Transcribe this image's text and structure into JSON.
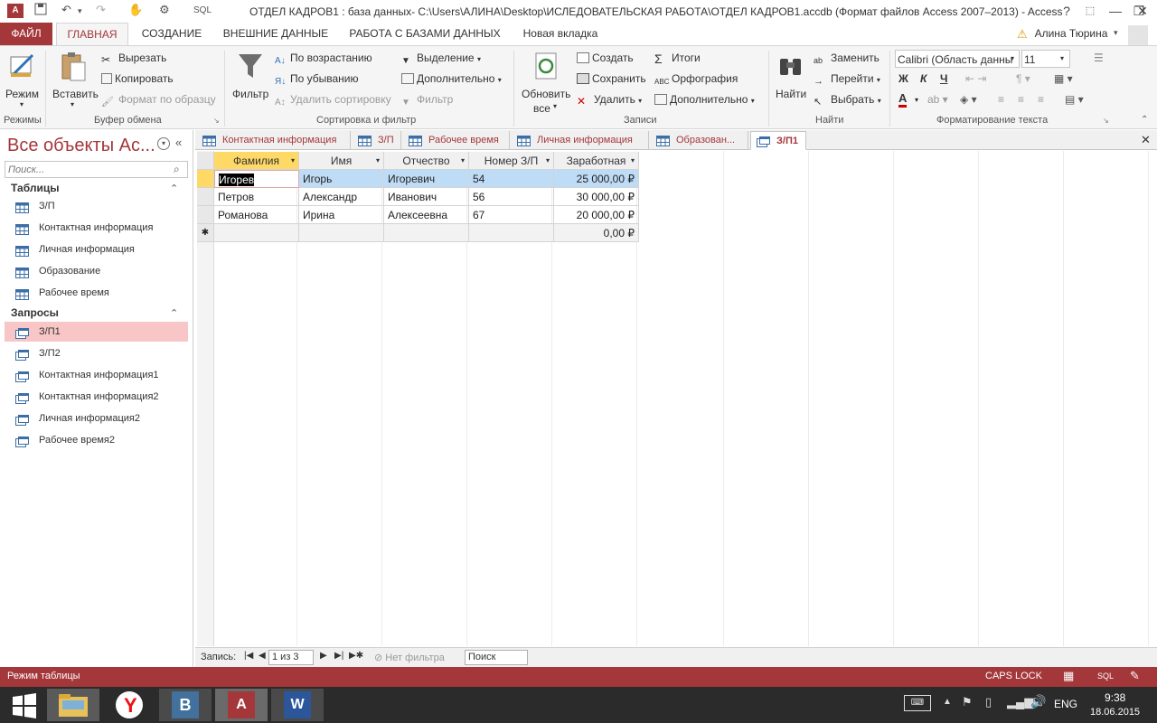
{
  "titlebar": {
    "title": "ОТДЕЛ КАДРОВ1 : база данных- C:\\Users\\АЛИНА\\Desktop\\ИСЛЕДОВАТЕЛЬСКАЯ РАБОТА\\ОТДЕЛ КАДРОВ1.accdb (Формат файлов Access 2007–2013) - Access",
    "sql_label": "SQL",
    "help": "?",
    "minimize": "—",
    "restore": "❐",
    "close": "✕"
  },
  "tabs": {
    "file": "ФАЙЛ",
    "home": "ГЛАВНАЯ",
    "create": "СОЗДАНИЕ",
    "external": "ВНЕШНИЕ ДАННЫЕ",
    "database": "РАБОТА С БАЗАМИ ДАННЫХ",
    "newtab": "Новая вкладка",
    "user": "Алина Тюрина"
  },
  "ribbon": {
    "mode": "Режим",
    "paste": "Вставить",
    "cut": "Вырезать",
    "copy": "Копировать",
    "format_painter": "Формат по образцу",
    "filter": "Фильтр",
    "asc": "По возрастанию",
    "desc": "По убыванию",
    "remove_sort": "Удалить сортировку",
    "selection": "Выделение",
    "advanced": "Дополнительно",
    "toggle_filter": "Фильтр",
    "refresh": "Обновить",
    "refresh2": "все",
    "new": "Создать",
    "save": "Сохранить",
    "delete": "Удалить",
    "totals": "Итоги",
    "spelling": "Орфография",
    "more": "Дополнительно",
    "find": "Найти",
    "replace": "Заменить",
    "goto": "Перейти",
    "select": "Выбрать",
    "font_name": "Calibri (Область данны",
    "font_size": "11",
    "bold": "Ж",
    "italic": "К",
    "underline": "Ч",
    "groups": {
      "modes": "Режимы",
      "clipboard": "Буфер обмена",
      "sortfilter": "Сортировка и фильтр",
      "records": "Записи",
      "find": "Найти",
      "textformat": "Форматирование текста"
    }
  },
  "nav": {
    "title": "Все объекты Ac...",
    "search_placeholder": "Поиск...",
    "tables_header": "Таблицы",
    "tables": [
      "З/П",
      "Контактная информация",
      "Личная информация",
      "Образование",
      "Рабочее время"
    ],
    "queries_header": "Запросы",
    "queries": [
      "З/П1",
      "З/П2",
      "Контактная информация1",
      "Контактная информация2",
      "Личная информация2",
      "Рабочее время2"
    ]
  },
  "doctabs": [
    "Контактная информация",
    "З/П",
    "Рабочее время",
    "Личная информация",
    "Образован...",
    "З/П1"
  ],
  "sheet": {
    "columns": [
      "Фамилия",
      "Имя",
      "Отчество",
      "Номер З/П",
      "Заработная"
    ],
    "rows": [
      [
        "Игорев",
        "Игорь",
        "Игоревич",
        "54",
        "25 000,00 ₽"
      ],
      [
        "Петров",
        "Александр",
        "Иванович",
        "56",
        "30 000,00 ₽"
      ],
      [
        "Романова",
        "Ирина",
        "Алексеевна",
        "67",
        "20 000,00 ₽"
      ]
    ],
    "new_row_marker": "✱",
    "new_row_value": "0,00 ₽"
  },
  "recnav": {
    "label": "Запись:",
    "position": "1 из 3",
    "no_filter": "Нет фильтра",
    "search": "Поиск"
  },
  "status": {
    "mode": "Режим таблицы",
    "caps": "CAPS LOCK",
    "sql": "SQL"
  },
  "taskbar": {
    "lang": "ENG",
    "time": "9:38",
    "date": "18.06.2015"
  },
  "colors": {
    "accent": "#a4373a",
    "selected_header": "#ffd966",
    "selected_row": "#bfdcf7",
    "nav_selected": "#f8c6c6"
  }
}
